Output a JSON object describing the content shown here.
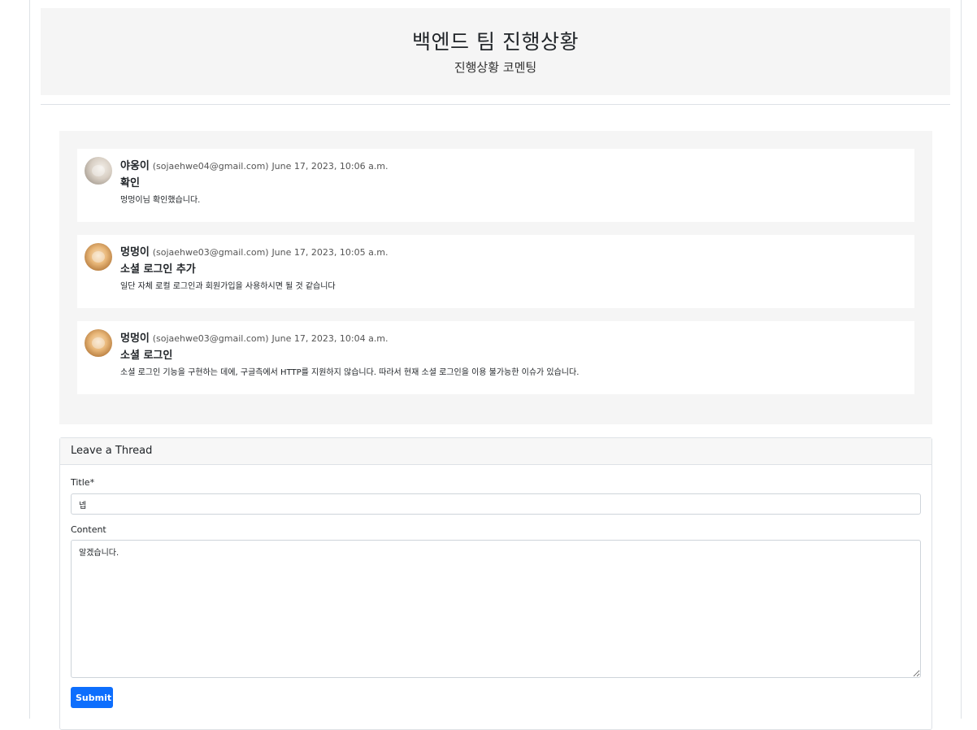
{
  "header": {
    "title": "백엔드 팀 진행상황",
    "subtitle": "진행상황 코멘팅"
  },
  "threads": [
    {
      "author": "야옹이",
      "email": "(sojaehwe04@gmail.com)",
      "date": "June 17, 2023, 10:06 a.m.",
      "title": "확인",
      "content": "멍멍이님 확인했습니다."
    },
    {
      "author": "멍멍이",
      "email": "(sojaehwe03@gmail.com)",
      "date": "June 17, 2023, 10:05 a.m.",
      "title": "소셜 로그인 추가",
      "content": "일단 자체 로컬 로그인과 회원가입을 사용하시면 될 것 같습니다"
    },
    {
      "author": "멍멍이",
      "email": "(sojaehwe03@gmail.com)",
      "date": "June 17, 2023, 10:04 a.m.",
      "title": "소셜 로그인",
      "content": "소셜 로그인 기능을 구현하는 데에, 구글측에서 HTTP를 지원하지 않습니다. 따라서 현재 소셜 로그인을 이용 불가능한 이슈가 있습니다."
    }
  ],
  "form": {
    "heading": "Leave a Thread",
    "title_label": "Title*",
    "title_value": "넵",
    "content_label": "Content",
    "content_value": "알겠습니다.",
    "submit_label": "Submit"
  },
  "colors": {
    "primary": "#0d6efd",
    "panel": "#f5f5f5"
  }
}
